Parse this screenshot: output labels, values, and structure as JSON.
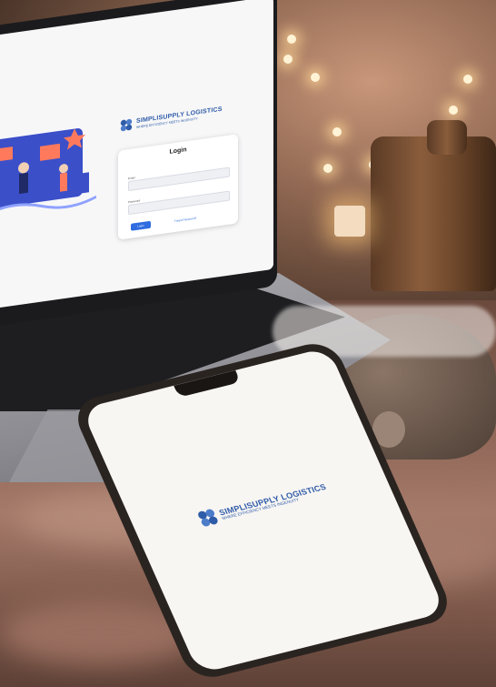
{
  "laptop": {
    "brand_name": "SIMPLISUPPLY LOGISTICS",
    "brand_tagline": "WHERE EFFICIENCY MEETS INGENUITY",
    "login": {
      "title": "Login",
      "email_label": "Email",
      "password_label": "Password",
      "button_label": "Login",
      "link_label": "Forgot Password?"
    }
  },
  "phone": {
    "brand_name": "SIMPLISUPPLY LOGISTICS",
    "brand_tagline": "WHERE EFFICIENCY MEETS INGENUITY"
  },
  "colors": {
    "brand_blue": "#2f5ca8",
    "button_blue": "#2f6ce0",
    "blanket": "#8a6253",
    "ambient_glow": "#fff3d6"
  },
  "icons": [
    "logo-icon",
    "illustration-image",
    "string-light-icon",
    "candle-icon"
  ]
}
